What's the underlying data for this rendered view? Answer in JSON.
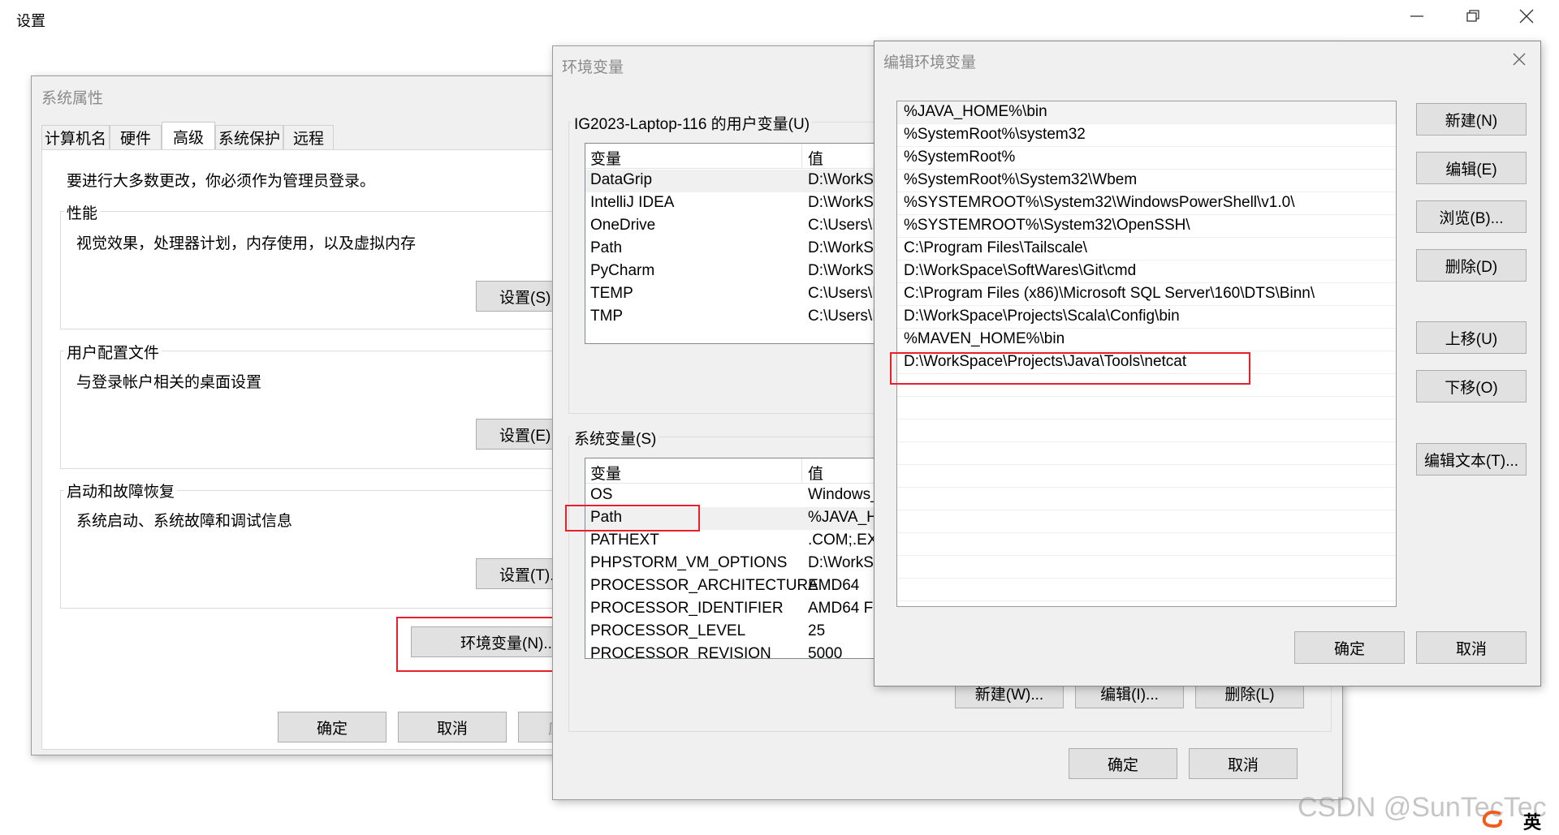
{
  "window": {
    "title": "设置"
  },
  "sysprops": {
    "title": "系统属性",
    "tabs": [
      "计算机名",
      "硬件",
      "高级",
      "系统保护",
      "远程"
    ],
    "admin_note": "要进行大多数更改，你必须作为管理员登录。",
    "perf": {
      "label": "性能",
      "desc": "视觉效果，处理器计划，内存使用，以及虚拟内存",
      "button": "设置(S)..."
    },
    "profile": {
      "label": "用户配置文件",
      "desc": "与登录帐户相关的桌面设置",
      "button": "设置(E)..."
    },
    "startup": {
      "label": "启动和故障恢复",
      "desc": "系统启动、系统故障和调试信息",
      "button": "设置(T)..."
    },
    "env_button": "环境变量(N)...",
    "ok": "确定",
    "cancel": "取消",
    "apply": "应"
  },
  "envvars": {
    "title": "环境变量",
    "user_group": "IG2023-Laptop-116 的用户变量(U)",
    "col_var": "变量",
    "col_val": "值",
    "user_rows": [
      {
        "name": "DataGrip",
        "value": "D:\\WorkSp"
      },
      {
        "name": "IntelliJ IDEA",
        "value": "D:\\WorkSp"
      },
      {
        "name": "OneDrive",
        "value": "C:\\Users\\I"
      },
      {
        "name": "Path",
        "value": "D:\\WorkSp"
      },
      {
        "name": "PyCharm",
        "value": "D:\\WorkSp"
      },
      {
        "name": "TEMP",
        "value": "C:\\Users\\I"
      },
      {
        "name": "TMP",
        "value": "C:\\Users\\I"
      }
    ],
    "sys_group": "系统变量(S)",
    "sys_rows": [
      {
        "name": "OS",
        "value": "Windows_"
      },
      {
        "name": "Path",
        "value": "%JAVA_H"
      },
      {
        "name": "PATHEXT",
        "value": ".COM;.EXE"
      },
      {
        "name": "PHPSTORM_VM_OPTIONS",
        "value": "D:\\WorkSp"
      },
      {
        "name": "PROCESSOR_ARCHITECTURE",
        "value": "AMD64"
      },
      {
        "name": "PROCESSOR_IDENTIFIER",
        "value": "AMD64 F"
      },
      {
        "name": "PROCESSOR_LEVEL",
        "value": "25"
      },
      {
        "name": "PROCESSOR_REVISION",
        "value": "5000"
      }
    ],
    "sys_new": "新建(W)...",
    "sys_edit": "编辑(I)...",
    "sys_delete": "删除(L)",
    "ok": "确定",
    "cancel": "取消"
  },
  "editenv": {
    "title": "编辑环境变量",
    "entries": [
      "%JAVA_HOME%\\bin",
      "%SystemRoot%\\system32",
      "%SystemRoot%",
      "%SystemRoot%\\System32\\Wbem",
      "%SYSTEMROOT%\\System32\\WindowsPowerShell\\v1.0\\",
      "%SYSTEMROOT%\\System32\\OpenSSH\\",
      "C:\\Program Files\\Tailscale\\",
      "D:\\WorkSpace\\SoftWares\\Git\\cmd",
      "C:\\Program Files (x86)\\Microsoft SQL Server\\160\\DTS\\Binn\\",
      "D:\\WorkSpace\\Projects\\Scala\\Config\\bin",
      "%MAVEN_HOME%\\bin",
      "D:\\WorkSpace\\Projects\\Java\\Tools\\netcat"
    ],
    "buttons": {
      "new": "新建(N)",
      "edit": "编辑(E)",
      "browse": "浏览(B)...",
      "delete": "删除(D)",
      "up": "上移(U)",
      "down": "下移(O)",
      "edit_text": "编辑文本(T)..."
    },
    "ok": "确定",
    "cancel": "取消"
  },
  "watermark": "CSDN @SunTecTec",
  "ime": "英",
  "colors": {
    "highlight": "#e8202c",
    "dialog_bg": "#f0f0f0",
    "button_bg": "#e1e1e1"
  }
}
